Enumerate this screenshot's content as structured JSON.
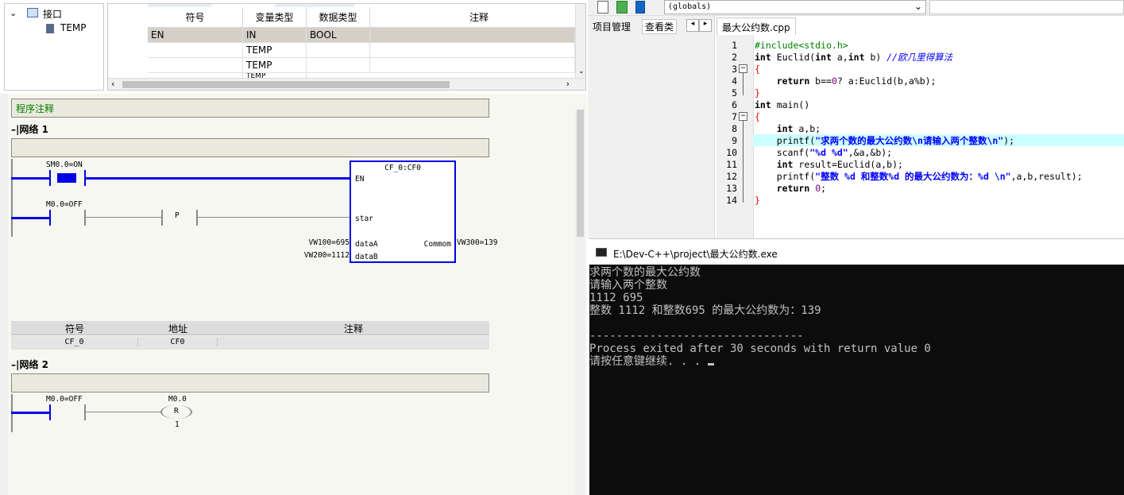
{
  "tree": {
    "interface": "接口",
    "temp": "TEMP"
  },
  "iftable": {
    "headers": [
      "符号",
      "变量类型",
      "数据类型",
      "注释"
    ],
    "rows": [
      [
        "EN",
        "IN",
        "BOOL",
        ""
      ],
      [
        "",
        "TEMP",
        "",
        ""
      ],
      [
        "",
        "TEMP",
        "",
        ""
      ],
      [
        "",
        "TEMP",
        "",
        ""
      ]
    ]
  },
  "ladder": {
    "program_comment": "程序注释",
    "network1": "网络 1",
    "network2": "网络 2",
    "n1": {
      "contact1": "SM0.0=ON",
      "contact2": "M0.0=OFF",
      "p_label": "P",
      "block_title": "CF_0:CF0",
      "pin_en": "EN",
      "pin_star": "star",
      "pin_dataA": "dataA",
      "pin_dataB": "dataB",
      "pin_out": "Commom",
      "in_a": "VW100=695",
      "in_b": "VW200=1112",
      "out": "VW300=139"
    },
    "symtable": {
      "headers": [
        "符号",
        "地址",
        "注释"
      ],
      "row": [
        "CF_0",
        "CF0",
        ""
      ]
    },
    "n2": {
      "contact": "M0.0=OFF",
      "coil_addr": "M0.0",
      "coil_type": "R",
      "coil_n": "1"
    }
  },
  "ide": {
    "globals": "(globals)",
    "tab_project": "项目管理",
    "tab_view": "查看类",
    "file_tab": "最大公约数.cpp",
    "lines": [
      "#include<stdio.h>",
      "int Euclid(int a,int b) //欧几里得算法",
      "{",
      "    return b==0? a:Euclid(b,a%b);",
      "}",
      "int main()",
      "{",
      "    int a,b;",
      "    printf(\"求两个数的最大公约数\\n请输入两个整数\\n\");",
      "    scanf(\"%d %d\",&a,&b);",
      "    int result=Euclid(a,b);",
      "    printf(\"整数 %d 和整数%d 的最大公约数为：%d \\n\",a,b,result);",
      "    return 0;",
      "}"
    ],
    "line_numbers": [
      "1",
      "2",
      "3",
      "4",
      "5",
      "6",
      "7",
      "8",
      "9",
      "10",
      "11",
      "12",
      "13",
      "14"
    ]
  },
  "console": {
    "title": "E:\\Dev-C++\\project\\最大公约数.exe",
    "lines": [
      "求两个数的最大公约数",
      "请输入两个整数",
      "1112 695",
      "整数 1112 和整数695 的最大公约数为：139",
      "",
      "--------------------------------",
      "Process exited after 30 seconds with return value 0",
      "请按任意键继续. . . "
    ]
  }
}
